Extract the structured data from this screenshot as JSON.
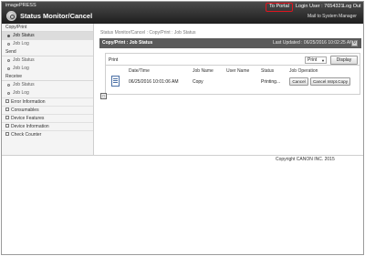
{
  "header": {
    "brand": "imagePRESS",
    "title": "Status Monitor/Cancel",
    "to_portal": "To Portal",
    "login_user": "Login User : 7654321",
    "logout": "Log Out",
    "mail_link": "Mail to System Manager"
  },
  "sidebar": {
    "groups": [
      {
        "label": "Copy/Print",
        "items": [
          "Job Status",
          "Job Log"
        ]
      },
      {
        "label": "Send",
        "items": [
          "Job Status",
          "Job Log"
        ]
      },
      {
        "label": "Receive",
        "items": [
          "Job Status",
          "Job Log"
        ]
      }
    ],
    "links": [
      "Error Information",
      "Consumables",
      "Device Features",
      "Device Information",
      "Check Counter"
    ]
  },
  "main": {
    "breadcrumb": "Status Monitor/Cancel : Copy/Print : Job Status",
    "panel_title": "Copy/Print : Job Status",
    "last_updated": "Last Updated : 06/25/2016 10:02:25 AM",
    "list_label": "Print",
    "filter_value": "Print",
    "display_button": "Display",
    "columns": [
      "Date/Time",
      "Job Name",
      "User Name",
      "Status",
      "Job Operation"
    ],
    "row": {
      "date_time": "06/25/2016 10:01:06 AM",
      "job_name": "Copy",
      "user_name": "",
      "status": "Printing...",
      "cancel": "Cancel",
      "cancel_interrupt": "Cancel Intrpt.Copy"
    }
  },
  "footer": {
    "copyright": "Copyright CANON INC. 2015"
  }
}
